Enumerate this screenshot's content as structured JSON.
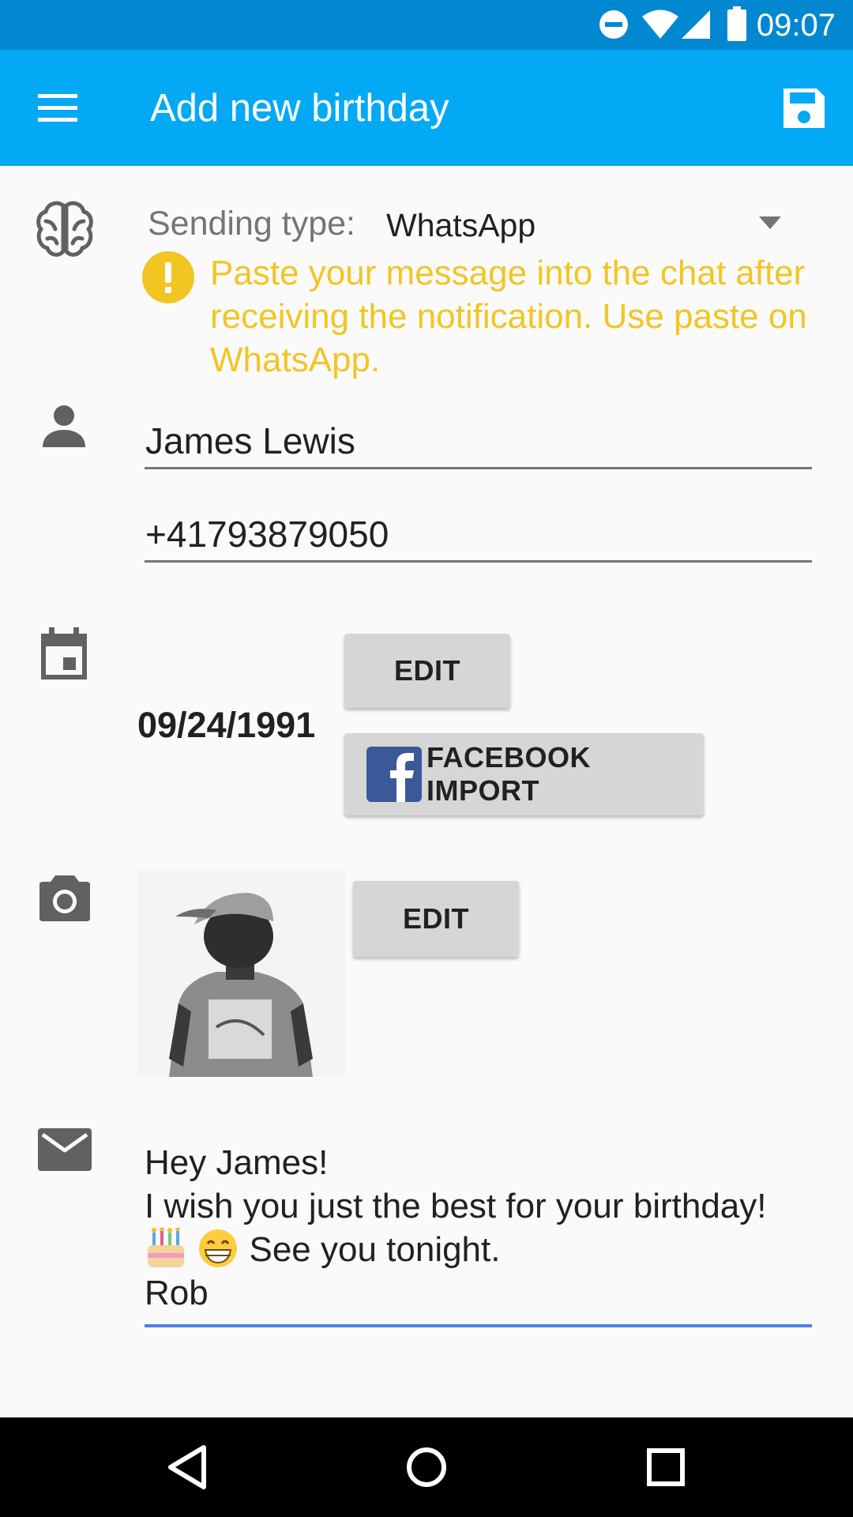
{
  "status_bar": {
    "time": "09:07",
    "icons": [
      "do-not-disturb-icon",
      "wifi-icon",
      "signal-icon",
      "battery-icon"
    ]
  },
  "app_bar": {
    "title": "Add new birthday",
    "menu_icon": "menu-icon",
    "save_icon": "save-icon",
    "background_color": "#03a9f4",
    "status_color": "#0288d1"
  },
  "sending": {
    "label": "Sending type:",
    "value": "WhatsApp",
    "warning": "Paste your message into the chat after receiving the notification. Use paste on WhatsApp.",
    "warning_color": "#f2c523"
  },
  "contact": {
    "name": "James Lewis",
    "phone": "+41793879050"
  },
  "date": {
    "value": "09/24/1991",
    "edit_label": "EDIT",
    "facebook_label": "FACEBOOK IMPORT"
  },
  "photo": {
    "edit_label": "EDIT"
  },
  "message": {
    "line1": "Hey James!",
    "line2": "I wish you just the best for your birthday!",
    "line3": "See you tonight.",
    "line3_emojis": [
      "birthday-cake-icon",
      "grinning-face-icon"
    ],
    "line4": "Rob",
    "focus_color": "#4e7fe6"
  },
  "nav_bar": {
    "buttons": [
      "back-icon",
      "home-icon",
      "recents-icon"
    ]
  }
}
